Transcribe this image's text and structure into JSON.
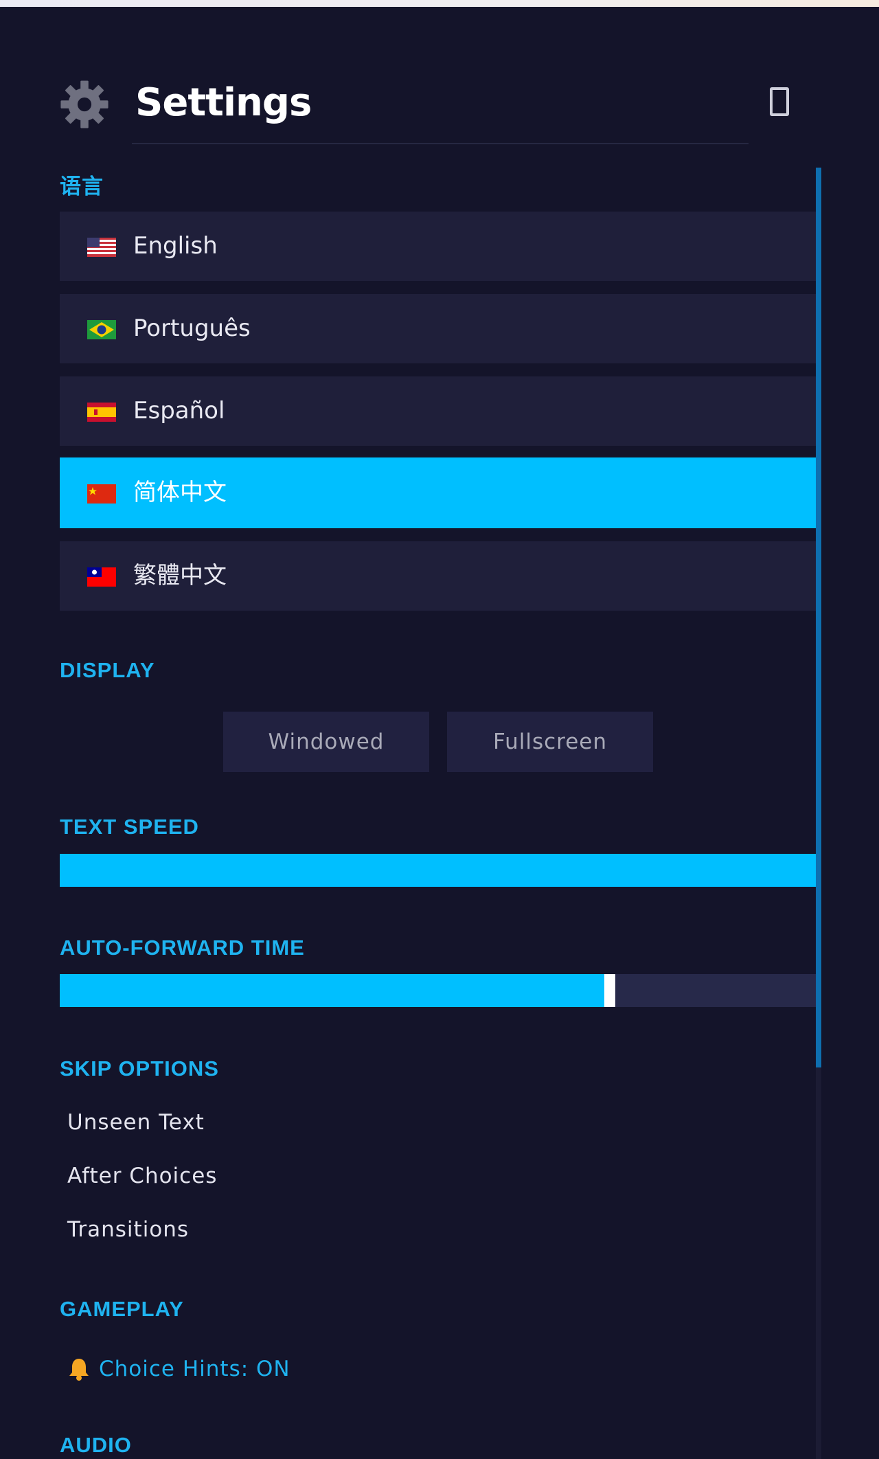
{
  "header": {
    "title": "Settings",
    "settings_icon": "gear-icon",
    "close_icon": "window-icon"
  },
  "language": {
    "label": "语言",
    "items": [
      {
        "label": "English",
        "flag": "us-flag-icon",
        "selected": false
      },
      {
        "label": "Português",
        "flag": "brazil-flag-icon",
        "selected": false
      },
      {
        "label": "Español",
        "flag": "spain-flag-icon",
        "selected": false
      },
      {
        "label": "简体中文",
        "flag": "china-flag-icon",
        "selected": true
      },
      {
        "label": "繁體中文",
        "flag": "taiwan-flag-icon",
        "selected": false
      }
    ]
  },
  "display": {
    "label": "DISPLAY",
    "windowed": "Windowed",
    "fullscreen": "Fullscreen"
  },
  "text_speed": {
    "label": "TEXT SPEED",
    "value_fraction": 1.0
  },
  "auto_forward": {
    "label": "AUTO-FORWARD TIME",
    "value_fraction": 0.72
  },
  "skip_options": {
    "label": "SKIP OPTIONS",
    "items": [
      "Unseen Text",
      "After Choices",
      "Transitions"
    ]
  },
  "gameplay": {
    "label": "GAMEPLAY",
    "choice_hints": "Choice Hints: ON",
    "hint_icon": "bell-icon"
  },
  "audio": {
    "label": "AUDIO"
  },
  "colors": {
    "accent": "#00bfff",
    "background": "#14142a",
    "item_bg": "#1f1f3a"
  }
}
